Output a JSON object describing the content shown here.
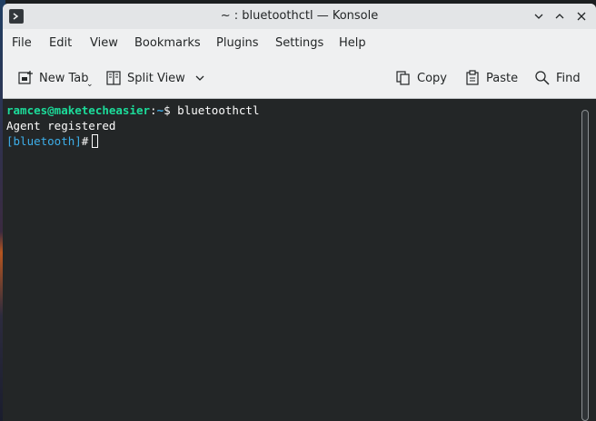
{
  "window": {
    "title": "~ : bluetoothctl — Konsole"
  },
  "menu": {
    "items": [
      "File",
      "Edit",
      "View",
      "Bookmarks",
      "Plugins",
      "Settings",
      "Help"
    ]
  },
  "toolbar": {
    "new_tab": "New Tab",
    "split_view": "Split View",
    "copy": "Copy",
    "paste": "Paste",
    "find": "Find"
  },
  "terminal": {
    "user_host": "ramces@maketecheasier",
    "colon": ":",
    "cwd": "~",
    "prompt_symbol": "$",
    "command": "bluetoothctl",
    "output": "Agent registered",
    "bt_prompt": "[bluetooth]",
    "bt_symbol": "#"
  },
  "colors": {
    "terminal_bg": "#232627",
    "user_host": "#1cdc9a",
    "path": "#3daee9",
    "bt_prompt": "#3daee9",
    "chrome_bg": "#eff0f1"
  }
}
